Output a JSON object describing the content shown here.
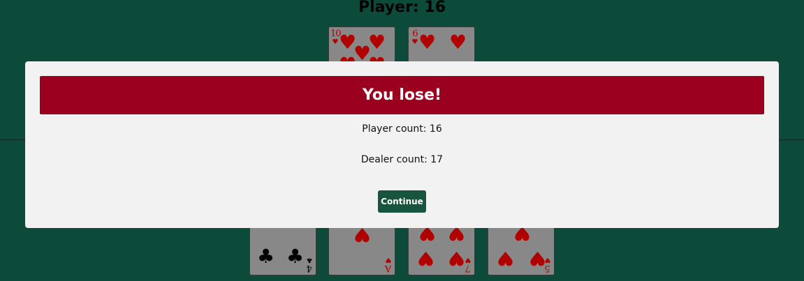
{
  "player": {
    "title": "Player: 16",
    "cards": [
      {
        "rank": "10",
        "suit": "♥",
        "color": "#b00000"
      },
      {
        "rank": "6",
        "suit": "♥",
        "color": "#b00000"
      }
    ]
  },
  "dealer": {
    "cards": [
      {
        "rank": "4",
        "suit": "♣",
        "color": "#000000"
      },
      {
        "rank": "A",
        "suit": "♥",
        "color": "#b00000"
      },
      {
        "rank": "7",
        "suit": "♥",
        "color": "#b00000"
      },
      {
        "rank": "5",
        "suit": "♥",
        "color": "#b00000"
      }
    ]
  },
  "modal": {
    "heading": "You lose!",
    "player_count": "Player count: 16",
    "dealer_count": "Dealer count: 17",
    "continue_label": "Continue"
  },
  "colors": {
    "table": "#0c4a3a",
    "banner": "#9b001e",
    "button": "#17553e",
    "card_face": "#888888"
  }
}
